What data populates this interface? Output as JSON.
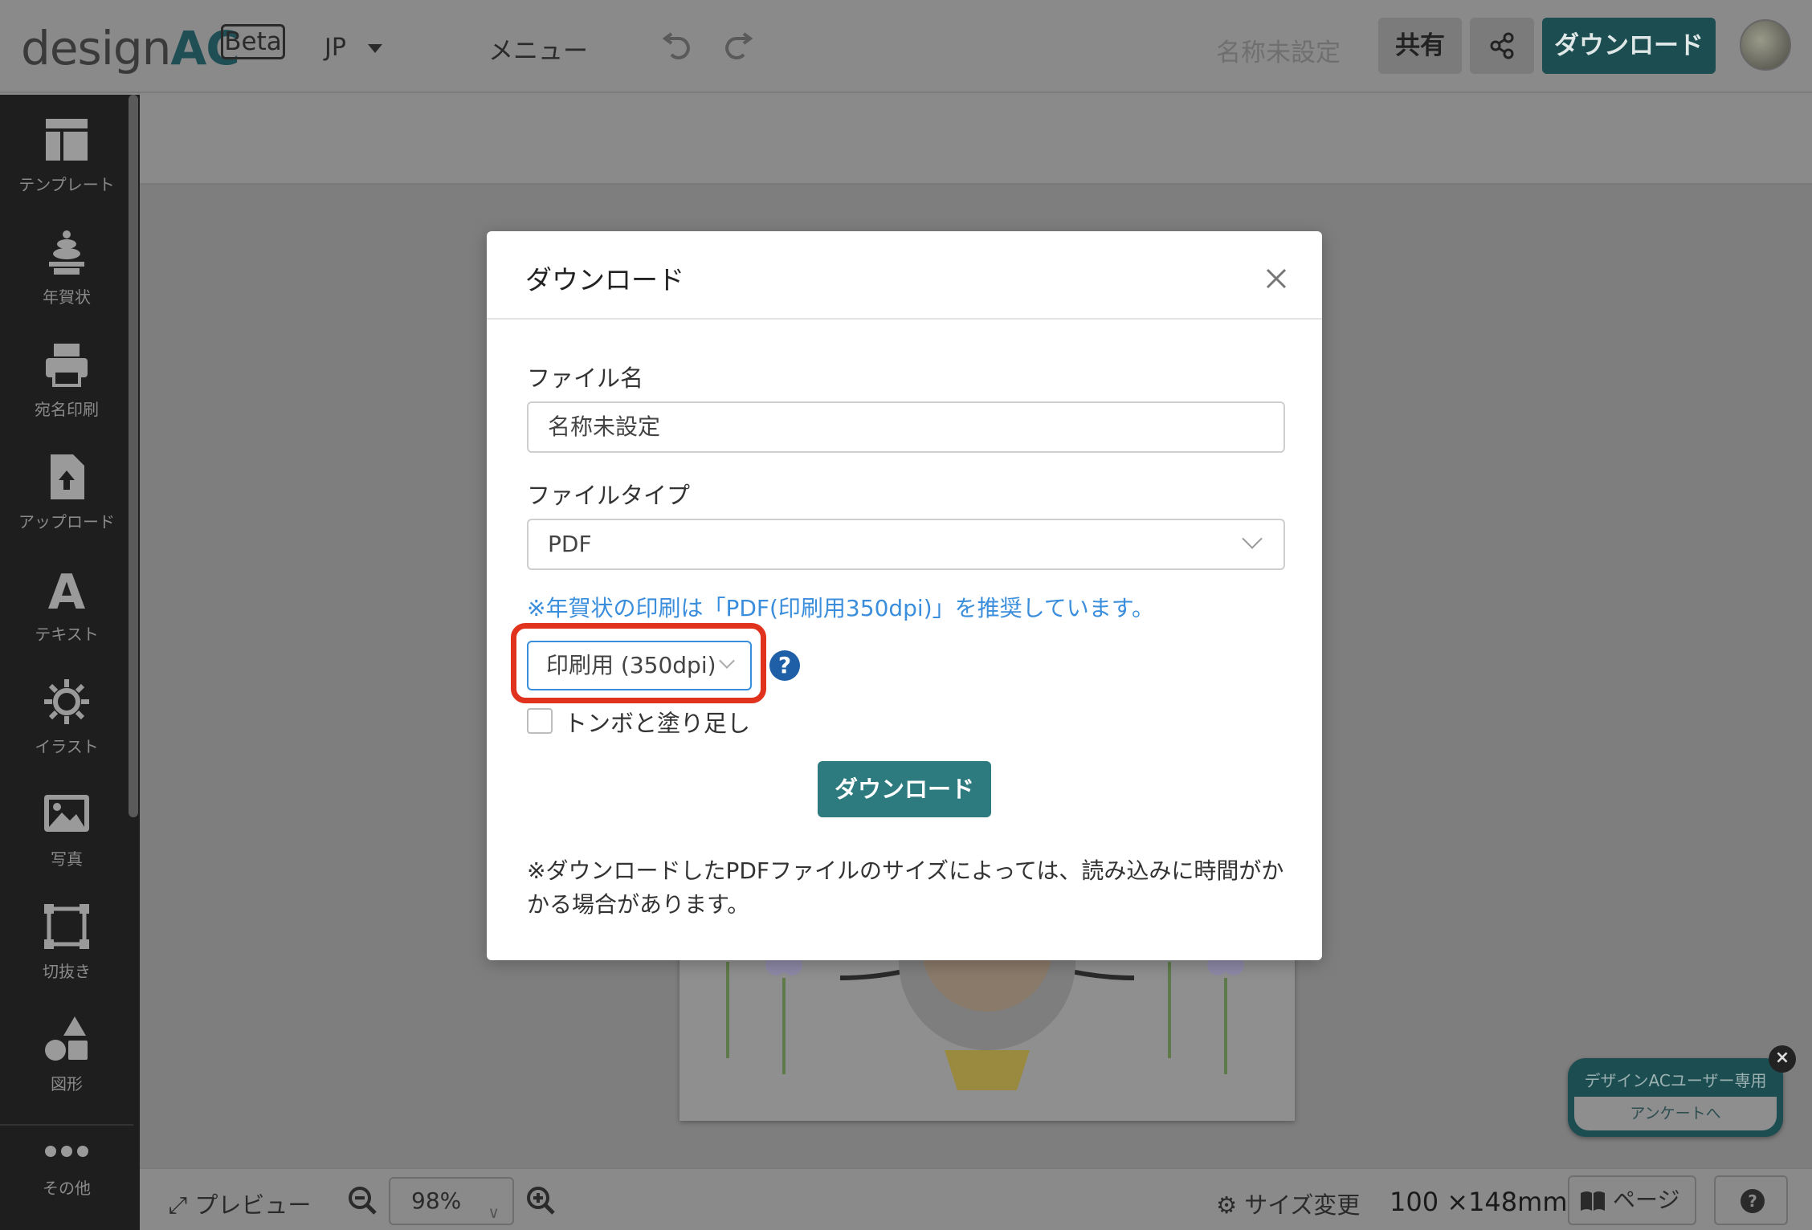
{
  "header": {
    "logo_text": "design",
    "logo_accent": "AC",
    "beta_label": "Beta",
    "language": "JP",
    "menu_label": "メニュー",
    "document_name": "名称未設定",
    "share_label": "共有",
    "download_label": "ダウンロード"
  },
  "sidebar": {
    "items": [
      {
        "label": "テンプレート",
        "icon": "template-icon"
      },
      {
        "label": "年賀状",
        "icon": "kagami-mochi-icon"
      },
      {
        "label": "宛名印刷",
        "icon": "printer-icon"
      },
      {
        "label": "アップロード",
        "icon": "upload-file-icon"
      },
      {
        "label": "テキスト",
        "icon": "text-icon"
      },
      {
        "label": "イラスト",
        "icon": "sun-gear-icon"
      },
      {
        "label": "写真",
        "icon": "photo-icon"
      },
      {
        "label": "切抜き",
        "icon": "crop-icon"
      },
      {
        "label": "図形",
        "icon": "shapes-icon"
      },
      {
        "label": "その他",
        "icon": "more-dots-icon"
      }
    ]
  },
  "bottombar": {
    "preview_label": "プレビュー",
    "zoom": "98%",
    "resize_label": "サイズ変更",
    "size": "100 ×148mm",
    "page_label": "ページ"
  },
  "survey": {
    "title": "デザインACユーザー専用",
    "button": "アンケートへ"
  },
  "modal": {
    "title": "ダウンロード",
    "filename_label": "ファイル名",
    "filename_value": "名称未設定",
    "filetype_label": "ファイルタイプ",
    "filetype_value": "PDF",
    "recommend_note": "※年賀状の印刷は「PDF(印刷用350dpi)」を推奨しています。",
    "dpi_value": "印刷用 (350dpi)",
    "crop_marks_label": "トンボと塗り足し",
    "crop_marks_checked": false,
    "download_button": "ダウンロード",
    "bottom_note": "※ダウンロードしたPDFファイルのサイズによっては、読み込みに時間がかかる場合があります。"
  },
  "colors": {
    "accent_teal": "#2e7b7f",
    "link_blue": "#3a8edc",
    "highlight_red": "#e1321e"
  }
}
